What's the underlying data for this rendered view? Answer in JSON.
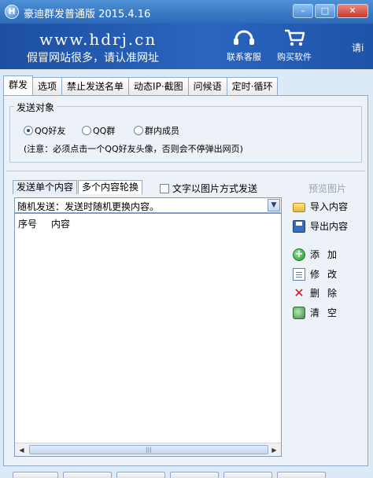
{
  "window": {
    "title": "豪迪群发普通版 2015.4.16",
    "icon_glyph": "H",
    "controls": {
      "minimize": "–",
      "maximize": "□",
      "close": "✕"
    }
  },
  "banner": {
    "site": "www.hdrj.cn",
    "warning": "假冒网站很多，请认准网址",
    "service_label": "联系客服",
    "buy_label": "购买软件",
    "cut_text": "请i"
  },
  "tabs": [
    {
      "label": "群发",
      "active": true
    },
    {
      "label": "选项",
      "active": false
    },
    {
      "label": "禁止发送名单",
      "active": false
    },
    {
      "label": "动态IP·截图",
      "active": false
    },
    {
      "label": "问候语",
      "active": false
    },
    {
      "label": "定时·循环",
      "active": false
    }
  ],
  "target": {
    "title": "发送对象",
    "options": [
      {
        "label": "QQ好友",
        "selected": true
      },
      {
        "label": "QQ群",
        "selected": false
      },
      {
        "label": "群内成员",
        "selected": false
      }
    ],
    "note": "(注意：必须点击一个QQ好友头像，否则会不停弹出网页)"
  },
  "content": {
    "subtabs": [
      {
        "label": "发送单个内容",
        "active": false
      },
      {
        "label": "多个内容轮换",
        "active": true
      }
    ],
    "image_send_checkbox": {
      "label": "文字以图片方式发送",
      "checked": false
    },
    "preview_label": "预览图片",
    "mode_select": {
      "value": "随机发送：发送时随机更换内容。",
      "arrow": "▼"
    },
    "list": {
      "columns": [
        "序号",
        "内容"
      ],
      "rows": [],
      "scroll_left": "◀",
      "scroll_right": "▶",
      "thumb_grip": "|||"
    }
  },
  "side_actions": {
    "import": "导入内容",
    "export": "导出内容",
    "add": "添加",
    "edit": "修改",
    "delete": "删除",
    "clear": "清空",
    "add_glyph": "+",
    "delete_glyph": "✕"
  },
  "colors": {
    "titlebar": "#2a6ab8",
    "banner": "#2b65bf",
    "panel": "#edf2f9",
    "border": "#8ea9c9"
  }
}
